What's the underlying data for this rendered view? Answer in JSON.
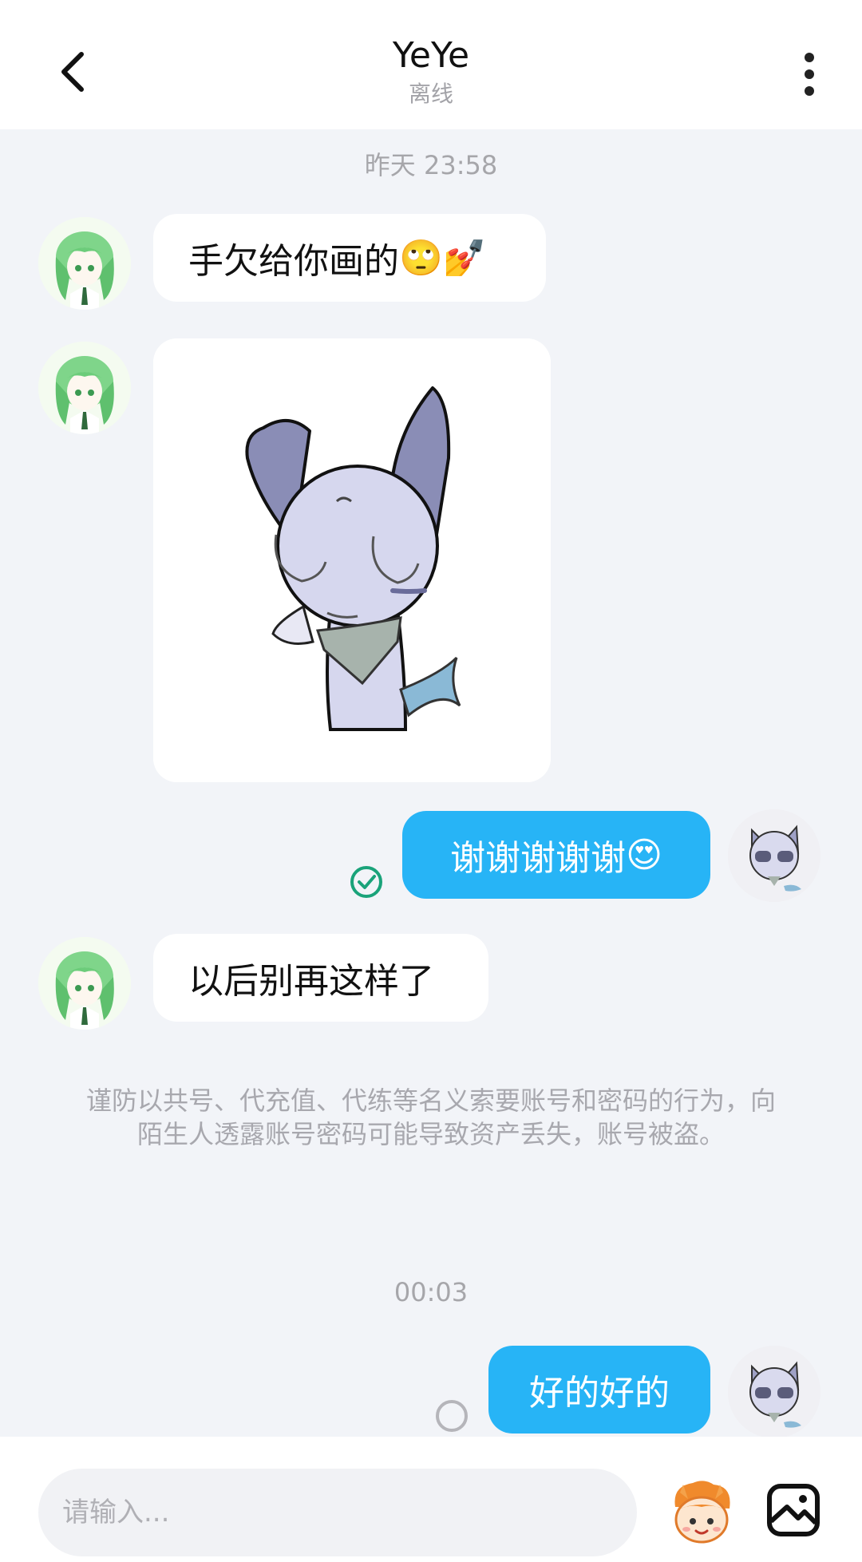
{
  "header": {
    "title": "YeYe",
    "status": "离线"
  },
  "messages": {
    "timestamp_1": "昨天 23:58",
    "msg_1_text": "手欠给你画的",
    "msg_1_emoji": "🙄💅",
    "msg_3_text": "谢谢谢谢谢",
    "msg_3_emoji": "😍",
    "msg_4_text": "以后别再这样了",
    "notice": "谨防以共号、代充值、代练等名义索要账号和密码的行为，向陌生人透露账号密码可能导致资产丢失，账号被盗。",
    "timestamp_2": "00:03",
    "msg_5_text": "好的好的"
  },
  "input": {
    "placeholder": "请输入..."
  },
  "icons": {
    "back": "chevron-left-icon",
    "more": "more-vertical-icon",
    "read": "check-circle-icon",
    "pending": "pending-circle-icon",
    "emoji": "emoji-face-icon",
    "image": "image-icon"
  },
  "colors": {
    "accent_bubble": "#27b4f6",
    "read_check": "#1aa37a",
    "background": "#f2f4f8"
  }
}
